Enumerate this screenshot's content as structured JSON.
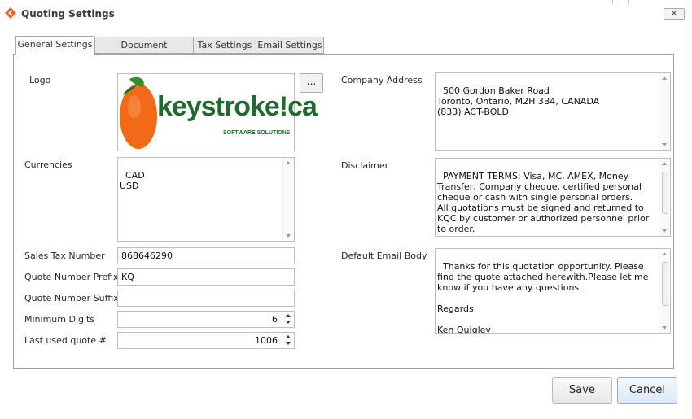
{
  "window": {
    "title": "Quoting Settings",
    "close_glyph": "✕",
    "app_icon": "app-logo-icon"
  },
  "tabs": [
    {
      "label": "General Settings",
      "active": true
    },
    {
      "label": "Document Formatting",
      "active": false
    },
    {
      "label": "Tax Settings",
      "active": false
    },
    {
      "label": "Email Settings",
      "active": false
    }
  ],
  "form": {
    "logo_label": "Logo",
    "logo": {
      "main_text": "keystroke!ca",
      "sub_text": "SOFTWARE SOLUTIONS"
    },
    "browse_label": "...",
    "currencies_label": "Currencies",
    "currencies": "CAD\nUSD",
    "sales_tax_label": "Sales Tax Number",
    "sales_tax_value": "868646290",
    "quote_prefix_label": "Quote Number Prefix",
    "quote_prefix_value": "KQ",
    "quote_suffix_label": "Quote Number Suffix",
    "quote_suffix_value": "",
    "min_digits_label": "Minimum Digits",
    "min_digits_value": "6",
    "last_quote_label": "Last used quote #",
    "last_quote_value": "1006",
    "company_address_label": "Company Address",
    "company_address": "500 Gordon Baker Road\nToronto, Ontario, M2H 3B4, CANADA\n(833) ACT-BOLD",
    "disclaimer_label": "Disclaimer",
    "disclaimer": "PAYMENT TERMS: Visa, MC, AMEX, Money Transfer, Company cheque, certified personal cheque or cash with single personal orders.\nAll quotations must be signed and returned to KQC by customer or authorized personnel prior to order.\n\nSIGNED ESTIMATES FORM A LEGALLY BINDING",
    "email_body_label": "Default Email Body",
    "email_body": "Thanks for this quotation opportunity. Please find the quote attached herewith.Please let me know if you have any questions.\n\nRegards,\n\nKen Quigley"
  },
  "buttons": {
    "save": "Save",
    "cancel": "Cancel"
  },
  "colors": {
    "accent": "#e8642c",
    "logo_green": "#1f6b2e",
    "tab_border": "#a8a8a8"
  }
}
